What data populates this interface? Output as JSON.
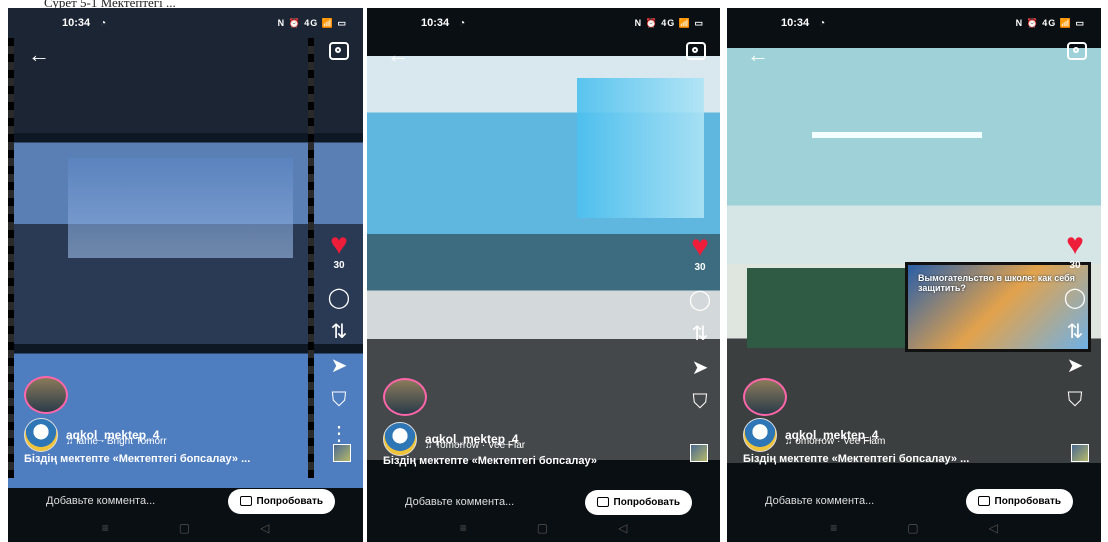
{
  "top_caption": "Сурет 5-1 Мектептегі ...",
  "phones": [
    {
      "status": {
        "time": "10:34",
        "right": "N ⏰ 4G 📶 ▭"
      },
      "likes": "30",
      "username": "aqkol_mektep_4",
      "music": "lame · Bright Tomorr",
      "caption": "Біздің мектепте «Мектептегі бопсалау» ...",
      "comment_placeholder": "Добавьте коммента...",
      "try_button": "Попробовать",
      "icons": {
        "back": "arrow-left-icon",
        "camera": "camera-icon",
        "heart": "heart-icon",
        "comment": "comment-icon",
        "repost": "repost-icon",
        "share": "send-icon",
        "save": "bookmark-icon"
      }
    },
    {
      "status": {
        "time": "10:34",
        "right": "N ⏰ 4G 📶 ▭"
      },
      "likes": "30",
      "username": "aqkol_mektep_4",
      "music": "Tomorrow · Vee Flar",
      "caption": "Біздің мектепте «Мектептегі бопсалау»",
      "comment_placeholder": "Добавьте коммента...",
      "try_button": "Попробовать"
    },
    {
      "status": {
        "time": "10:34",
        "right": "N ⏰ 4G 📶 ▭"
      },
      "likes": "30",
      "username": "aqkol_mektep_4",
      "music": "omorrow · Vee Flam",
      "caption": "Біздің мектепте «Мектептегі бопсалау» ...",
      "comment_placeholder": "Добавьте коммента...",
      "try_button": "Попробовать",
      "screen_title": "Вымогательство в школе: как себя защитить?"
    }
  ],
  "colors": {
    "like": "#ee1d3a",
    "background": "#0a0f14"
  }
}
